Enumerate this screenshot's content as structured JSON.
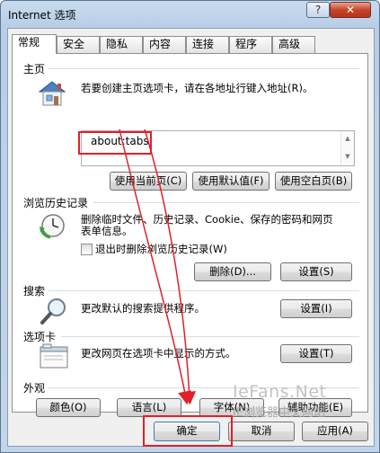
{
  "window": {
    "title": "Internet 选项",
    "help_label": "?",
    "close_label": "✕"
  },
  "tabs": [
    "常规",
    "安全",
    "隐私",
    "内容",
    "连接",
    "程序",
    "高级"
  ],
  "homepage": {
    "section_title": "主页",
    "description": "若要创建主页选项卡，请在各地址行键入地址(R)。",
    "url_value": "about:tabs",
    "buttons": [
      "使用当前页(C)",
      "使用默认值(F)",
      "使用空白页(B)"
    ]
  },
  "history": {
    "section_title": "浏览历史记录",
    "description_line1": "删除临时文件、历史记录、Cookie、保存的密码和网页",
    "description_line2": "表单信息。",
    "checkbox_label": "退出时删除浏览历史记录(W)",
    "delete_button": "删除(D)...",
    "settings_button": "设置(S)"
  },
  "search": {
    "section_title": "搜索",
    "description": "更改默认的搜索提供程序。",
    "settings_button": "设置(I)"
  },
  "tabs_section": {
    "section_title": "选项卡",
    "description": "更改网页在选项卡中显示的方式。",
    "settings_button": "设置(T)"
  },
  "appearance": {
    "section_title": "外观",
    "buttons": [
      "颜色(O)",
      "语言(L)",
      "字体(N)",
      "辅助功能(E)"
    ]
  },
  "dialog_buttons": {
    "ok": "确定",
    "cancel": "取消",
    "apply": "应用(A)"
  },
  "watermark": {
    "line1": "IeFans.Net",
    "line2": "IE浏览器中文网站"
  },
  "colors": {
    "annotation_red": "#e0202a",
    "title_bar": "#b9cee6"
  }
}
